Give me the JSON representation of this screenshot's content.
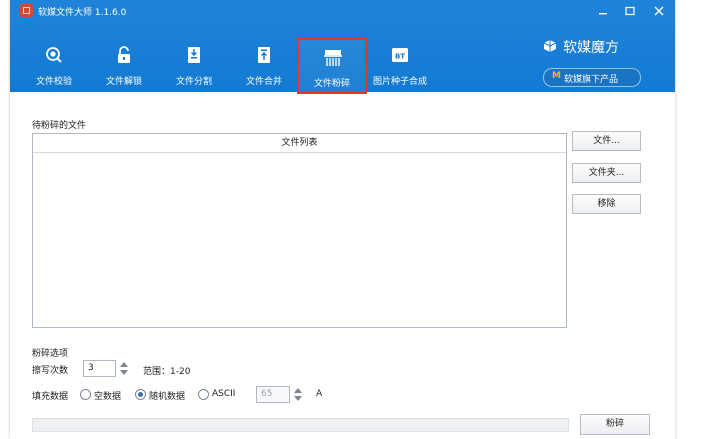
{
  "window": {
    "title": "软媒文件大师 1.1.6.0"
  },
  "colors": {
    "header": "#137ad2",
    "active_border": "#e0392b",
    "brand_accent": "#f7b620"
  },
  "toolbar": {
    "items": [
      {
        "label": "文件校验",
        "icon": "magnifier-icon"
      },
      {
        "label": "文件解锁",
        "icon": "unlock-icon"
      },
      {
        "label": "文件分割",
        "icon": "file-split-icon"
      },
      {
        "label": "文件合并",
        "icon": "file-merge-icon"
      },
      {
        "label": "文件粉碎",
        "icon": "shredder-icon",
        "active": true
      },
      {
        "label": "图片种子合成",
        "icon": "bt-icon",
        "badge": "BT"
      }
    ]
  },
  "brand": {
    "name": "软媒魔方",
    "button_letter": "M",
    "button_label": "软媒旗下产品"
  },
  "files": {
    "section_label": "待粉碎的文件",
    "column_header": "文件列表",
    "rows": []
  },
  "buttons": {
    "add_file": "文件...",
    "add_folder": "文件夹...",
    "remove": "移除",
    "shred": "粉碎"
  },
  "options": {
    "section_label": "粉碎选项",
    "overwrite_label": "擦写次数",
    "overwrite_value": "3",
    "range_label": "范围：1-20",
    "fill_label": "填充数据",
    "fill_choices": [
      "空数据",
      "随机数据",
      "ASCII"
    ],
    "fill_selected": "随机数据",
    "ascii_value": "65",
    "ascii_char": "A"
  },
  "progress": {
    "value": 0
  }
}
